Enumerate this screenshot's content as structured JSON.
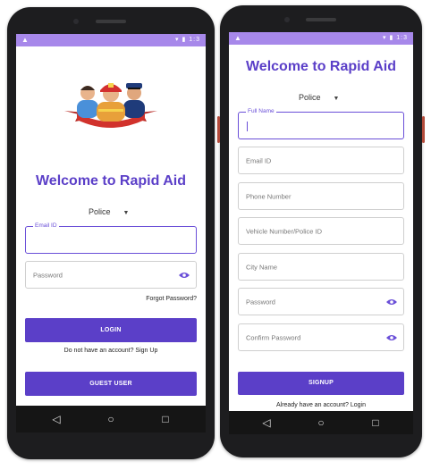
{
  "colors": {
    "accent": "#5b3fc8",
    "status_bar": "#a788ea",
    "nav_bar": "#151515"
  },
  "status_bar": {
    "left_icon": "warning-icon",
    "right_text": "▾ ▮ 1:3"
  },
  "login_screen": {
    "illustration": "police-firefighter-doctor-illustration",
    "title": "Welcome to Rapid Aid",
    "role_select": {
      "selected": "Police"
    },
    "email_field": {
      "floating_label": "Email ID",
      "value": ""
    },
    "password_field": {
      "placeholder": "Password"
    },
    "forgot_password": "Forgot Password?",
    "login_button": "LOGIN",
    "signup_prompt": "Do not have an account? Sign Up",
    "guest_button": "GUEST USER"
  },
  "signup_screen": {
    "title": "Welcome to Rapid Aid",
    "role_select": {
      "selected": "Police"
    },
    "fields": [
      {
        "label": "Full Name",
        "value": ""
      },
      {
        "placeholder": "Email ID"
      },
      {
        "placeholder": "Phone Number"
      },
      {
        "placeholder": "Vehicle Number/Police ID"
      },
      {
        "placeholder": "City Name"
      },
      {
        "placeholder": "Password"
      },
      {
        "placeholder": "Confirm Password"
      }
    ],
    "signup_button": "SIGNUP",
    "login_prompt": "Already have an account? Login"
  },
  "nav_bar": {
    "back_icon": "◁",
    "home_icon": "○",
    "recents_icon": "□"
  }
}
